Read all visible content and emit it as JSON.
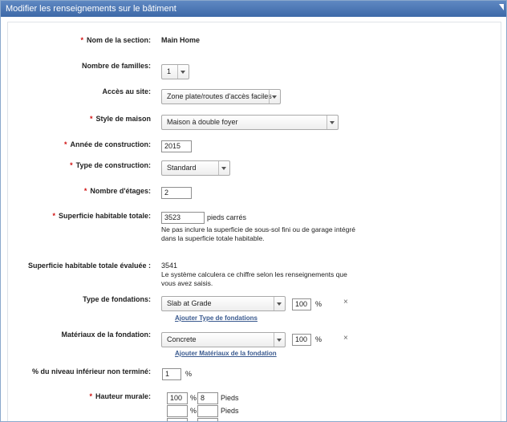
{
  "header": {
    "title": "Modifier les renseignements sur le bâtiment"
  },
  "section_name": {
    "label": "Nom de la section:",
    "value": "Main Home"
  },
  "families": {
    "label": "Nombre de familles:",
    "value": "1"
  },
  "site_access": {
    "label": "Accès au site:",
    "value": "Zone plate/routes d'accès faciles"
  },
  "house_style": {
    "label": "Style de maison",
    "value": "Maison à double foyer"
  },
  "year_built": {
    "label": "Année de construction:",
    "value": "2015"
  },
  "construction_type": {
    "label": "Type de construction:",
    "value": "Standard"
  },
  "stories": {
    "label": "Nombre d'étages:",
    "value": "2"
  },
  "living_area": {
    "label": "Superficie habitable totale:",
    "value": "3523",
    "unit": "pieds carrés",
    "note_line1": "Ne pas inclure la superficie de sous-sol fini ou de garage intégré",
    "note_line2": "dans la superficie totale habitable."
  },
  "estimated_area": {
    "label": "Superficie habitable totale évaluée :",
    "value": "3541",
    "note_line1": "Le système calculera ce chiffre selon les renseignements que",
    "note_line2": "vous avez saisis."
  },
  "foundation_type": {
    "label": "Type de fondations:",
    "value": "Slab at Grade",
    "percent": "100",
    "unit": "%",
    "add_link": "Ajouter Type de fondations"
  },
  "foundation_material": {
    "label": "Matériaux de la fondation:",
    "value": "Concrete",
    "percent": "100",
    "unit": "%",
    "add_link": "Ajouter Matériaux de la fondation"
  },
  "unfinished_lower": {
    "label": "% du niveau inférieur non terminé:",
    "value": "1",
    "unit": "%"
  },
  "wall_height": {
    "label": "Hauteur murale:",
    "rows": [
      {
        "percent": "100",
        "pct_sign": "%",
        "feet": "8",
        "feet_label": "Pieds"
      },
      {
        "percent": "",
        "pct_sign": "%",
        "feet": "",
        "feet_label": "Pieds"
      }
    ]
  },
  "remove_symbol": "×",
  "required_symbol": "*"
}
